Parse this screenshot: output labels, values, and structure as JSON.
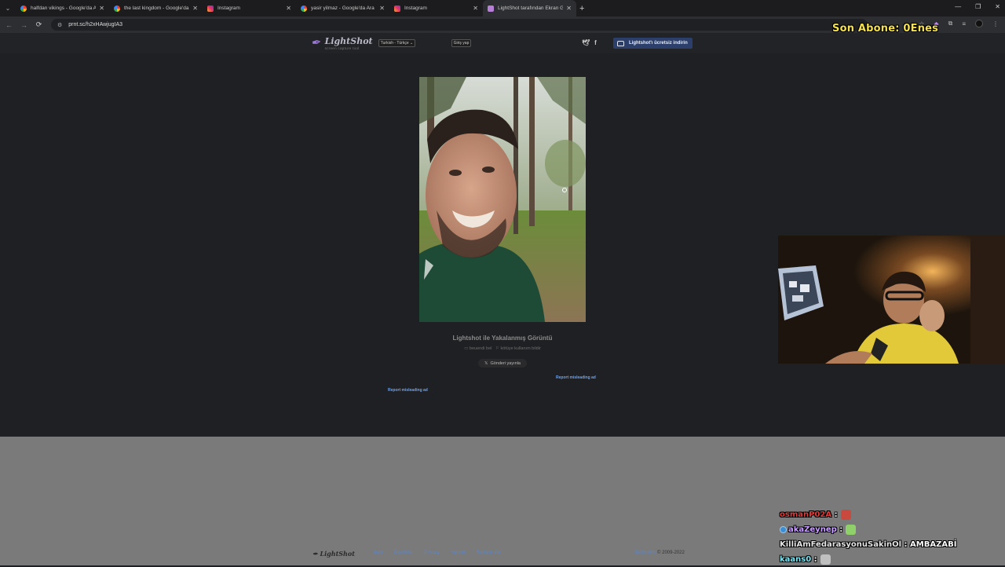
{
  "browser": {
    "tabs": [
      {
        "title": "halfdan vikings - Google'da Ara",
        "favicon": "google-icon",
        "active": false
      },
      {
        "title": "the last kingdom - Google'da Ara",
        "favicon": "google-icon",
        "active": false
      },
      {
        "title": "Instagram",
        "favicon": "instagram-icon",
        "active": false
      },
      {
        "title": "yasir yilmaz - Google'da Ara",
        "favicon": "google-icon",
        "active": false
      },
      {
        "title": "Instagram",
        "favicon": "instagram-icon",
        "active": false
      },
      {
        "title": "LightShot tarafından Ekran Görüntüsü",
        "favicon": "lightshot-icon",
        "active": true
      }
    ],
    "url": "prnt.sc/h2xHAwjugIA3"
  },
  "stream_overlay": {
    "subscriber": "Son Abone: 0Enes"
  },
  "lightshot": {
    "logo_text": "LightShot",
    "logo_subtitle": "screen capture tool",
    "language": "Turkish - Türkçe",
    "login": "Giriş yap",
    "download": "Lightshot'ı ücretsiz indirin",
    "caption": "Lightshot ile Yakalanmış Görüntü",
    "like_link": "beuendi bel",
    "report_link": "kötüye kullanım bildir",
    "share_button": "Gönderi yayınla",
    "report_ad_right": "Report misleading ad",
    "report_ad_left": "Report misleading ad",
    "footer": {
      "logo": "LightShot",
      "links": [
        "İndir",
        "Özellikler",
        "Privacy",
        "Yardım",
        "Reklam Ver"
      ],
      "brand": "Skillbrains",
      "copyright": "© 2009-2022"
    }
  },
  "chat": [
    {
      "user": "osmanP02A",
      "user_color": "#e03b3b",
      "msg": "",
      "emote": true,
      "emote_color": "#c9493e",
      "badge": false
    },
    {
      "user": "akaZeynep",
      "user_color": "#c9a0ff",
      "msg": "",
      "emote": true,
      "emote_color": "#8fd06a",
      "badge": true
    },
    {
      "user": "KilliAmFedarasyonuSakinOl",
      "user_color": "#e6e6e6",
      "msg": "AMBAZABİ",
      "emote": false,
      "emote_color": "",
      "badge": false
    },
    {
      "user": "kaans0",
      "user_color": "#7fe3f0",
      "msg": "",
      "emote": true,
      "emote_color": "#bfbfbf",
      "badge": false
    }
  ],
  "colors": {
    "page_bg": "#1f2023",
    "download_button": "#2b3f6a",
    "link_blue": "#6fa2e8",
    "overlay_yellow": "#f4e04d"
  }
}
